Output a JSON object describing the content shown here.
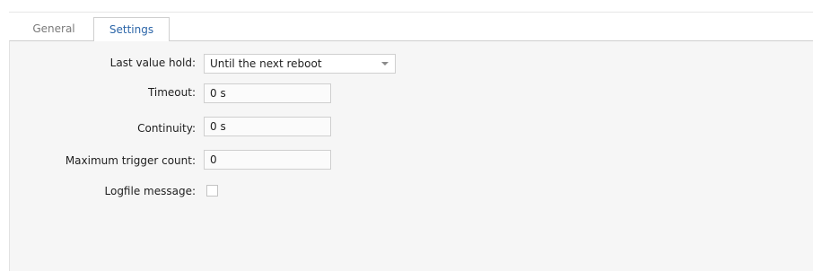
{
  "tabs": [
    {
      "label": "General",
      "active": false
    },
    {
      "label": "Settings",
      "active": true
    }
  ],
  "form": {
    "last_value_hold": {
      "label": "Last value hold:",
      "value": "Until the next reboot"
    },
    "timeout": {
      "label": "Timeout:",
      "value": "0 s"
    },
    "continuity": {
      "label": "Continuity:",
      "value": "0 s"
    },
    "max_trigger_count": {
      "label": "Maximum trigger count:",
      "value": "0"
    },
    "logfile_message": {
      "label": "Logfile message:",
      "checked": false
    }
  },
  "colors": {
    "active_tab_text": "#2b65a8",
    "inactive_tab_text": "#7a7a7a",
    "panel_background": "#f6f6f6",
    "field_border": "#cfcfcf"
  }
}
